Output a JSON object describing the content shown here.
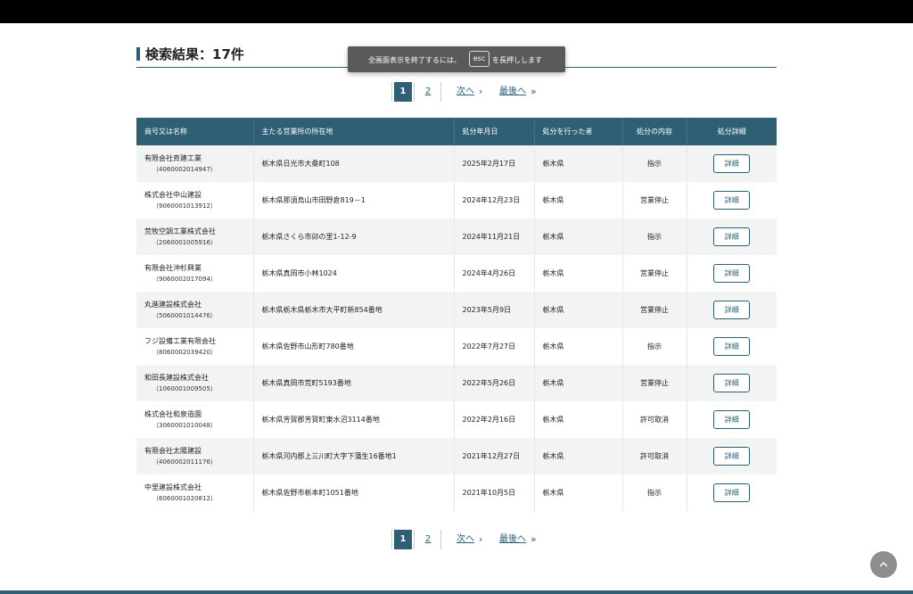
{
  "page": {
    "title": "検索結果：17件"
  },
  "toast": {
    "text_before": "全画面表示を終了するには、",
    "key": "esc",
    "text_after": "を長押しします"
  },
  "pager": {
    "current": "1",
    "page2": "2",
    "next": "次へ",
    "next_icon": "›",
    "last": "最後へ",
    "last_icon": "»"
  },
  "table": {
    "headers": [
      "商号又は名称",
      "主たる営業所の所在地",
      "処分年月日",
      "処分を行った者",
      "処分の内容",
      "処分詳細"
    ],
    "detail_label": "詳細",
    "rows": [
      {
        "name": "有限会社斉建工業",
        "corp_no": "（4060002014947）",
        "address": "栃木県日光市大桑町108",
        "date": "2025年2月17日",
        "authority": "栃木県",
        "action": "指示"
      },
      {
        "name": "株式会社中山建設",
        "corp_no": "（9060001013912）",
        "address": "栃木県那須烏山市田野倉819－1",
        "date": "2024年12月23日",
        "authority": "栃木県",
        "action": "営業停止"
      },
      {
        "name": "荒牧空調工業株式会社",
        "corp_no": "（2060001005916）",
        "address": "栃木県さくら市卯の里1-12-9",
        "date": "2024年11月21日",
        "authority": "栃木県",
        "action": "指示"
      },
      {
        "name": "有限会社沖杉興業",
        "corp_no": "（9060002017094）",
        "address": "栃木県真岡市小林1024",
        "date": "2024年4月26日",
        "authority": "栃木県",
        "action": "営業停止"
      },
      {
        "name": "丸進建設株式会社",
        "corp_no": "（5060001014476）",
        "address": "栃木県栃木県栃木市大平町新854番地",
        "date": "2023年5月9日",
        "authority": "栃木県",
        "action": "営業停止"
      },
      {
        "name": "フジ設備工業有限会社",
        "corp_no": "（8060002039420）",
        "address": "栃木県佐野市山形町780番地",
        "date": "2022年7月27日",
        "authority": "栃木県",
        "action": "指示"
      },
      {
        "name": "和田長建設株式会社",
        "corp_no": "（1060001009505）",
        "address": "栃木県真岡市荒町5193番地",
        "date": "2022年5月26日",
        "authority": "栃木県",
        "action": "営業停止"
      },
      {
        "name": "株式会社和泉造園",
        "corp_no": "（3060001010048）",
        "address": "栃木県芳賀郡芳賀町東水沼3114番地",
        "date": "2022年2月16日",
        "authority": "栃木県",
        "action": "許可取消"
      },
      {
        "name": "有限会社太陽建設",
        "corp_no": "（4060002011176）",
        "address": "栃木県河内郡上三川町大字下蒲生16番地1",
        "date": "2021年12月27日",
        "authority": "栃木県",
        "action": "許可取消"
      },
      {
        "name": "中里建設株式会社",
        "corp_no": "（6060001020812）",
        "address": "栃木県佐野市栃本町1051番地",
        "date": "2021年10月5日",
        "authority": "栃木県",
        "action": "指示"
      }
    ]
  },
  "scroll_top": {
    "icon": "chevron-up-icon"
  },
  "colors": {
    "accent": "#2e5f75",
    "row_alt": "#f2f3f3"
  }
}
